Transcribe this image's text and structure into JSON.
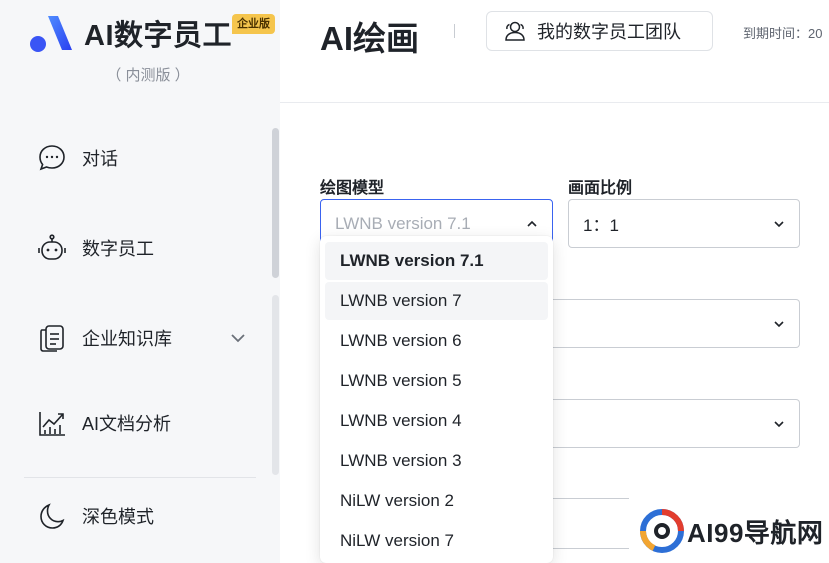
{
  "sidebar": {
    "brand": "AI数字员工",
    "badge": "企业版",
    "subtitle": "（ 内测版 ）",
    "items": [
      {
        "label": "对话",
        "icon": "chat-icon"
      },
      {
        "label": "数字员工",
        "icon": "robot-icon"
      },
      {
        "label": "企业知识库",
        "icon": "knowledge-base-icon"
      },
      {
        "label": "AI文档分析",
        "icon": "analytics-icon"
      },
      {
        "label": "深色模式",
        "icon": "moon-icon"
      }
    ]
  },
  "header": {
    "title": "AI绘画",
    "team_button": "我的数字员工团队",
    "expire_label": "到期时间：20"
  },
  "form": {
    "model_label": "绘图模型",
    "model_placeholder": "LWNB version 7.1",
    "ratio_label": "画面比例",
    "ratio_value": "1：1"
  },
  "dropdown": {
    "options": [
      "LWNB version 7.1",
      "LWNB version 7",
      "LWNB version 6",
      "LWNB version 5",
      "LWNB version 4",
      "LWNB version 3",
      "NiLW version 2",
      "NiLW version 7"
    ],
    "selected": "LWNB version 7.1",
    "hovered": "LWNB version 7"
  },
  "watermark": {
    "text": "AI99导航网"
  },
  "colors": {
    "accent": "#3a63f0",
    "brand_gradient_start": "#2a4ff5",
    "brand_gradient_end": "#4f8cff",
    "badge": "#f5c54d"
  }
}
